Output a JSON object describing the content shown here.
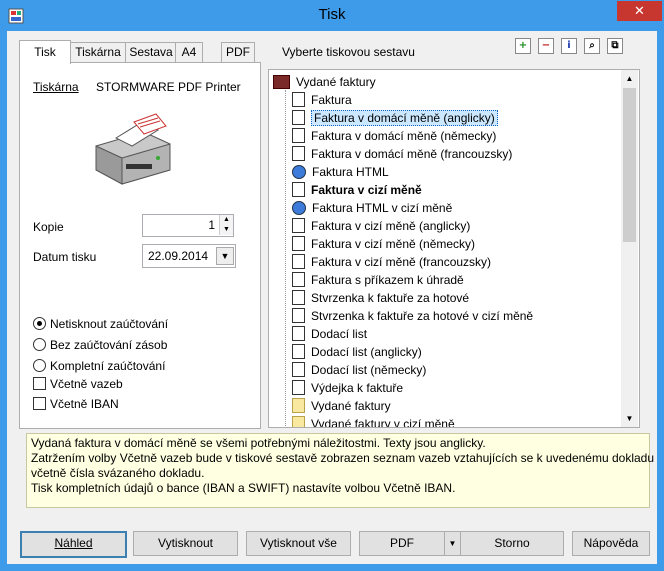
{
  "window": {
    "title": "Tisk",
    "close_glyph": "✕"
  },
  "tabs": [
    {
      "label": "Tisk",
      "active": true
    },
    {
      "label": "Tiskárna",
      "active": false
    },
    {
      "label": "Sestava",
      "active": false
    },
    {
      "label": "A4",
      "active": false
    },
    {
      "label": "PDF",
      "active": false
    }
  ],
  "report_hint": "Vyberte tiskovou sestavu",
  "toolbar": {
    "add_glyph": "+",
    "remove_glyph": "−",
    "info_glyph": "i",
    "find_glyph": "⌕",
    "copy_glyph": "⧉"
  },
  "printer": {
    "label": "Tiskárna",
    "name": "STORMWARE PDF Printer"
  },
  "copies": {
    "label": "Kopie",
    "value": "1",
    "up": "▲",
    "down": "▼"
  },
  "print_date": {
    "label": "Datum tisku",
    "value": "22.09.2014",
    "button": "▼"
  },
  "posting_options": [
    {
      "label": "Netisknout zaúčtování",
      "checked": true
    },
    {
      "label": "Bez zaúčtování zásob",
      "checked": false
    },
    {
      "label": "Kompletní zaúčtování",
      "checked": false
    }
  ],
  "checkboxes": [
    {
      "label": "Včetně vazeb",
      "checked": false
    },
    {
      "label": "Včetně IBAN",
      "checked": false
    }
  ],
  "tree": {
    "root": "Vydané faktury",
    "items": [
      {
        "label": "Faktura",
        "icon": "doc"
      },
      {
        "label": "Faktura v domácí měně (anglicky)",
        "icon": "doc",
        "selected": true
      },
      {
        "label": "Faktura v domácí měně (německy)",
        "icon": "doc"
      },
      {
        "label": "Faktura v domácí měně (francouzsky)",
        "icon": "doc"
      },
      {
        "label": "Faktura HTML",
        "icon": "html"
      },
      {
        "label": "Faktura v cizí měně",
        "icon": "doc",
        "bold": true
      },
      {
        "label": "Faktura HTML v cizí měně",
        "icon": "html"
      },
      {
        "label": "Faktura v cizí měně (anglicky)",
        "icon": "doc"
      },
      {
        "label": "Faktura v cizí měně (německy)",
        "icon": "doc"
      },
      {
        "label": "Faktura v cizí měně (francouzsky)",
        "icon": "doc"
      },
      {
        "label": "Faktura s příkazem k úhradě",
        "icon": "doc"
      },
      {
        "label": "Stvrzenka k faktuře za hotové",
        "icon": "doc"
      },
      {
        "label": "Stvrzenka k faktuře za hotové v cizí měně",
        "icon": "doc"
      },
      {
        "label": "Dodací list",
        "icon": "doc"
      },
      {
        "label": "Dodací list (anglicky)",
        "icon": "doc"
      },
      {
        "label": "Dodací list (německy)",
        "icon": "doc"
      },
      {
        "label": "Výdejka k faktuře",
        "icon": "doc"
      },
      {
        "label": "Vydané faktury",
        "icon": "folder"
      },
      {
        "label": "Vydané faktury v cizí měně",
        "icon": "folder"
      }
    ],
    "scroll_up": "▲",
    "scroll_down": "▼"
  },
  "description": [
    "Vydaná faktura v domácí měně se všemi potřebnými náležitostmi. Texty jsou anglicky.",
    "Zatržením volby Včetně vazeb bude v tiskové sestavě zobrazen seznam vazeb vztahujících se k uvedenému dokladu",
    "včetně čísla svázaného dokladu.",
    "Tisk kompletních údajů o bance (IBAN a SWIFT) nastavíte volbou Včetně IBAN."
  ],
  "buttons": {
    "preview": "Náhled",
    "print": "Vytisknout",
    "print_all": "Vytisknout vše",
    "pdf": "PDF",
    "pdf_arrow": "▼",
    "cancel": "Storno",
    "help": "Nápověda"
  }
}
